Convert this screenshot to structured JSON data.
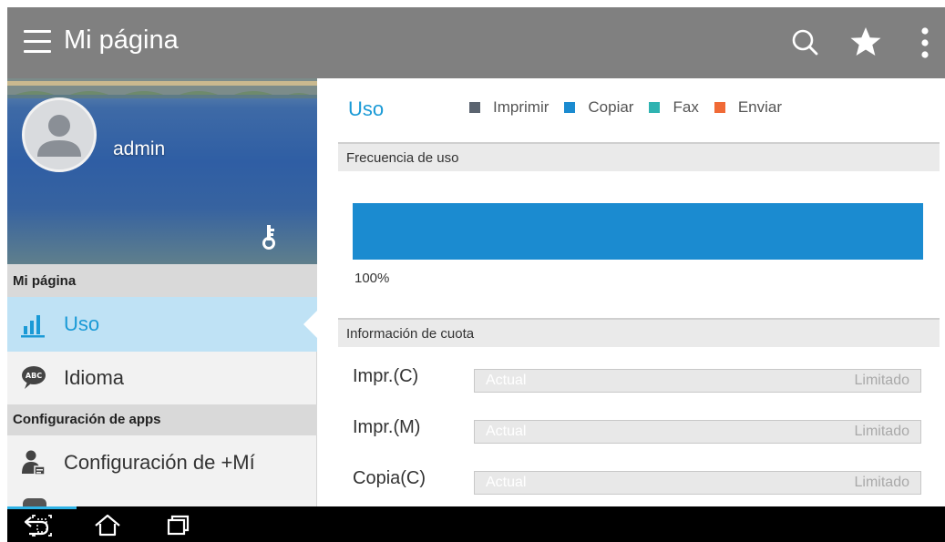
{
  "app_bar": {
    "title": "Mi página",
    "icons": [
      "menu-icon",
      "search-icon",
      "star-icon",
      "overflow-icon"
    ],
    "background": "#808080"
  },
  "drawer": {
    "username": "admin",
    "sections": [
      {
        "header": "Mi página",
        "items": [
          {
            "label": "Uso",
            "icon": "bar-chart-icon",
            "selected": true
          },
          {
            "label": "Idioma",
            "icon": "abc-bubble-icon",
            "selected": false
          }
        ]
      },
      {
        "header": "Configuración de apps",
        "items": [
          {
            "label": "Configuración de +Mí",
            "icon": "user-settings-icon",
            "selected": false
          }
        ]
      }
    ]
  },
  "content": {
    "title": "Uso",
    "legend": [
      {
        "label": "Imprimir",
        "color": "#5b6470"
      },
      {
        "label": "Copiar",
        "color": "#1b8bd0"
      },
      {
        "label": "Fax",
        "color": "#2fb3b1"
      },
      {
        "label": "Enviar",
        "color": "#f06a36"
      }
    ],
    "frequency": {
      "header": "Frecuencia de uso",
      "percent_label": "100%",
      "copy_fraction": 1.0
    },
    "quota": {
      "header": "Información de cuota",
      "rows": [
        {
          "label": "Impr.(C)",
          "actual": "Actual",
          "limit": "Limitado"
        },
        {
          "label": "Impr.(M)",
          "actual": "Actual",
          "limit": "Limitado"
        },
        {
          "label": "Copia(C)",
          "actual": "Actual",
          "limit": "Limitado"
        }
      ]
    }
  },
  "system_nav": {
    "buttons": [
      "back-icon",
      "home-icon",
      "recent-apps-icon",
      "screen-capture-icon"
    ],
    "accent": "#2fb3e6"
  }
}
